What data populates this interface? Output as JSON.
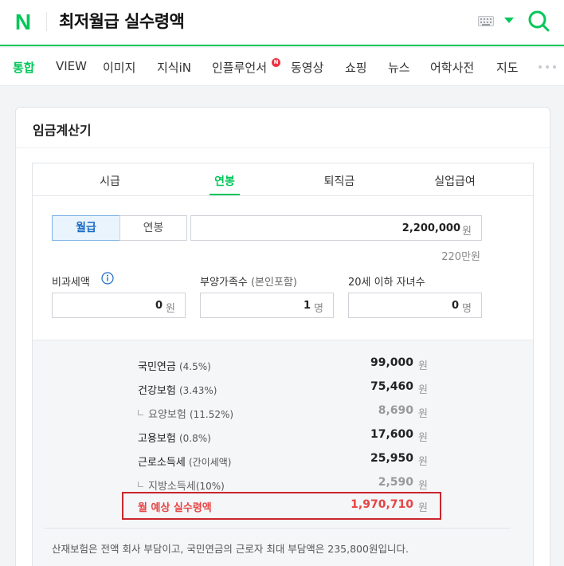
{
  "header": {
    "logo_letter": "N",
    "query": "최저월급 실수령액"
  },
  "tabs": [
    {
      "label": "통합",
      "active": true
    },
    {
      "label": "VIEW"
    },
    {
      "label": "이미지"
    },
    {
      "label": "지식iN"
    },
    {
      "label": "인플루언서",
      "badge": "N"
    },
    {
      "label": "동영상"
    },
    {
      "label": "쇼핑"
    },
    {
      "label": "뉴스"
    },
    {
      "label": "어학사전"
    },
    {
      "label": "지도"
    }
  ],
  "card": {
    "title": "임금계산기",
    "calc_tabs": [
      {
        "label": "시급"
      },
      {
        "label": "연봉",
        "active": true
      },
      {
        "label": "퇴직금"
      },
      {
        "label": "실업급여"
      }
    ],
    "period_toggle": {
      "monthly": "월급",
      "yearly": "연봉",
      "selected": "월급"
    },
    "salary": {
      "value": "2,200,000",
      "unit": "원",
      "sub": "220만원"
    },
    "fields": {
      "nontaxable": {
        "label": "비과세액",
        "value": "0",
        "unit": "원"
      },
      "dependents": {
        "label": "부양가족수",
        "label_paren": "(본인포함)",
        "value": "1",
        "unit": "명"
      },
      "children": {
        "label": "20세 이하 자녀수",
        "value": "0",
        "unit": "명"
      }
    },
    "results": [
      {
        "label": "국민연금",
        "rate": "(4.5%)",
        "value": "99,000",
        "unit": "원"
      },
      {
        "label": "건강보험",
        "rate": "(3.43%)",
        "value": "75,460",
        "unit": "원"
      },
      {
        "label": "요양보험",
        "rate": "(11.52%)",
        "value": "8,690",
        "unit": "원"
      },
      {
        "label": "고용보험",
        "rate": "(0.8%)",
        "value": "17,600",
        "unit": "원"
      },
      {
        "label": "근로소득세",
        "rate": "(간이세액)",
        "value": "25,950",
        "unit": "원"
      },
      {
        "label": "지방소득세",
        "rate": "(10%)",
        "value": "2,590",
        "unit": "원"
      }
    ],
    "net": {
      "label": "월 예상 실수령액",
      "value": "1,970,710",
      "unit": "원"
    },
    "footnote": "산재보험은 전액 회사 부담이고, 국민연금의 근로자 최대 부담액은 235,800원입니다."
  },
  "colors": {
    "brand_green": "#03c75a",
    "highlight_red": "#c9262c",
    "net_text_red": "#e64444"
  }
}
